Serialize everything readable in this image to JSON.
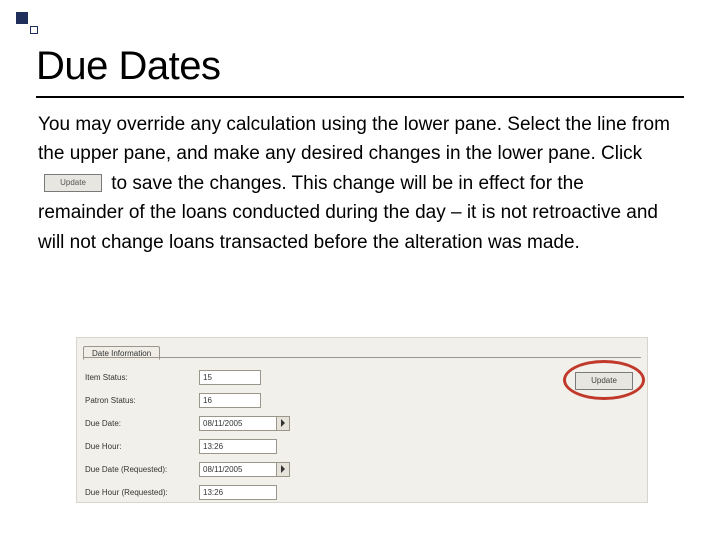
{
  "title": "Due Dates",
  "paragraph": {
    "p1": "You may override any calculation using the lower pane. Select the line from the upper pane, and make any desired changes in the lower pane.  Click ",
    "inline_btn": "Update",
    "p2": " to save the changes.  This change will be in effect for the remainder of the loans conducted during the day – it is not retroactive and will not change loans transacted before the alteration was made."
  },
  "screenshot": {
    "tab": "Date Information",
    "update_btn": "Update",
    "rows": {
      "item_status": {
        "label": "Item Status:",
        "value": "15"
      },
      "patron_status": {
        "label": "Patron Status:",
        "value": "16"
      },
      "due_date": {
        "label": "Due Date:",
        "value": "08/11/2005"
      },
      "due_hour": {
        "label": "Due Hour:",
        "value": "13:26"
      },
      "due_date_req": {
        "label": "Due Date (Requested):",
        "value": "08/11/2005"
      },
      "due_hour_req": {
        "label": "Due Hour (Requested):",
        "value": "13:26"
      }
    }
  }
}
